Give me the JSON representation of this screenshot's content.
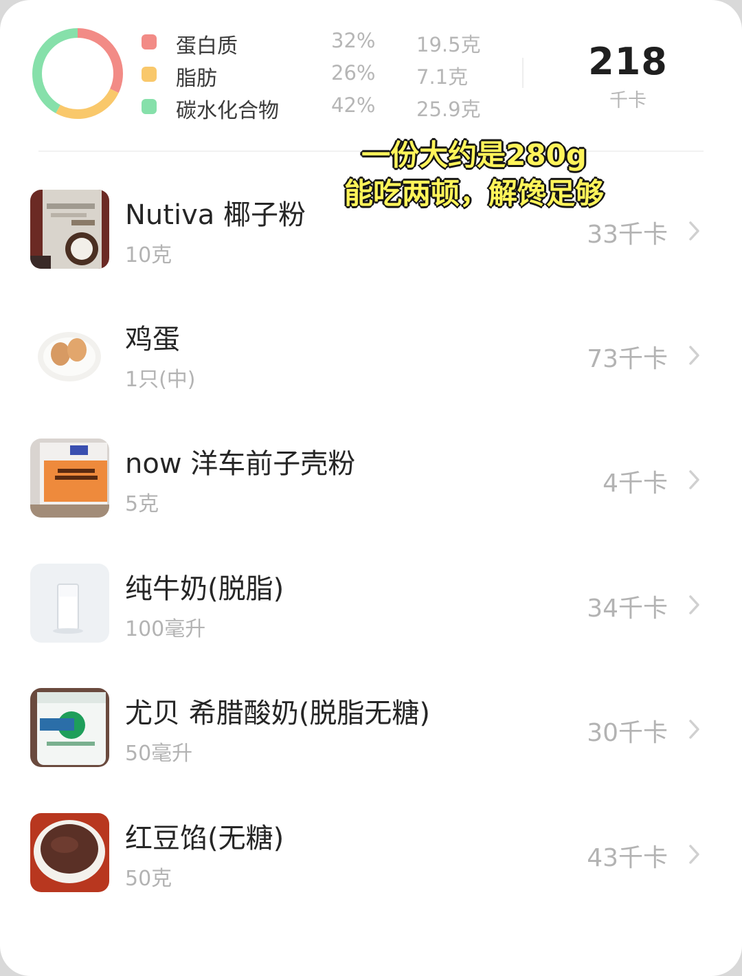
{
  "summary": {
    "macros": [
      {
        "name": "蛋白质",
        "percent": "32%",
        "amount": "19.5克",
        "color": "#f28b86"
      },
      {
        "name": "脂肪",
        "percent": "26%",
        "amount": "7.1克",
        "color": "#f9c86b"
      },
      {
        "name": "碳水化合物",
        "percent": "42%",
        "amount": "25.9克",
        "color": "#86e0aa"
      }
    ],
    "total_kcal": "218",
    "total_unit": "千卡"
  },
  "overlay": {
    "line1": "一份大约是280g",
    "line2": "能吃两顿，解馋足够"
  },
  "foods": [
    {
      "name": "Nutiva 椰子粉",
      "amount": "10克",
      "kcal": "33千卡",
      "icon": "coconut-flour-bag-photo"
    },
    {
      "name": "鸡蛋",
      "amount": "1只(中)",
      "kcal": "73千卡",
      "icon": "eggs-on-plate-photo"
    },
    {
      "name": "now 洋车前子壳粉",
      "amount": "5克",
      "kcal": "4千卡",
      "icon": "psyllium-husk-bag-photo"
    },
    {
      "name": "纯牛奶(脱脂)",
      "amount": "100毫升",
      "kcal": "34千卡",
      "icon": "glass-of-milk-photo"
    },
    {
      "name": "尤贝 希腊酸奶(脱脂无糖)",
      "amount": "50毫升",
      "kcal": "30千卡",
      "icon": "yogurt-tub-photo"
    },
    {
      "name": "红豆馅(无糖)",
      "amount": "50克",
      "kcal": "43千卡",
      "icon": "red-bean-paste-bowl-photo"
    }
  ]
}
